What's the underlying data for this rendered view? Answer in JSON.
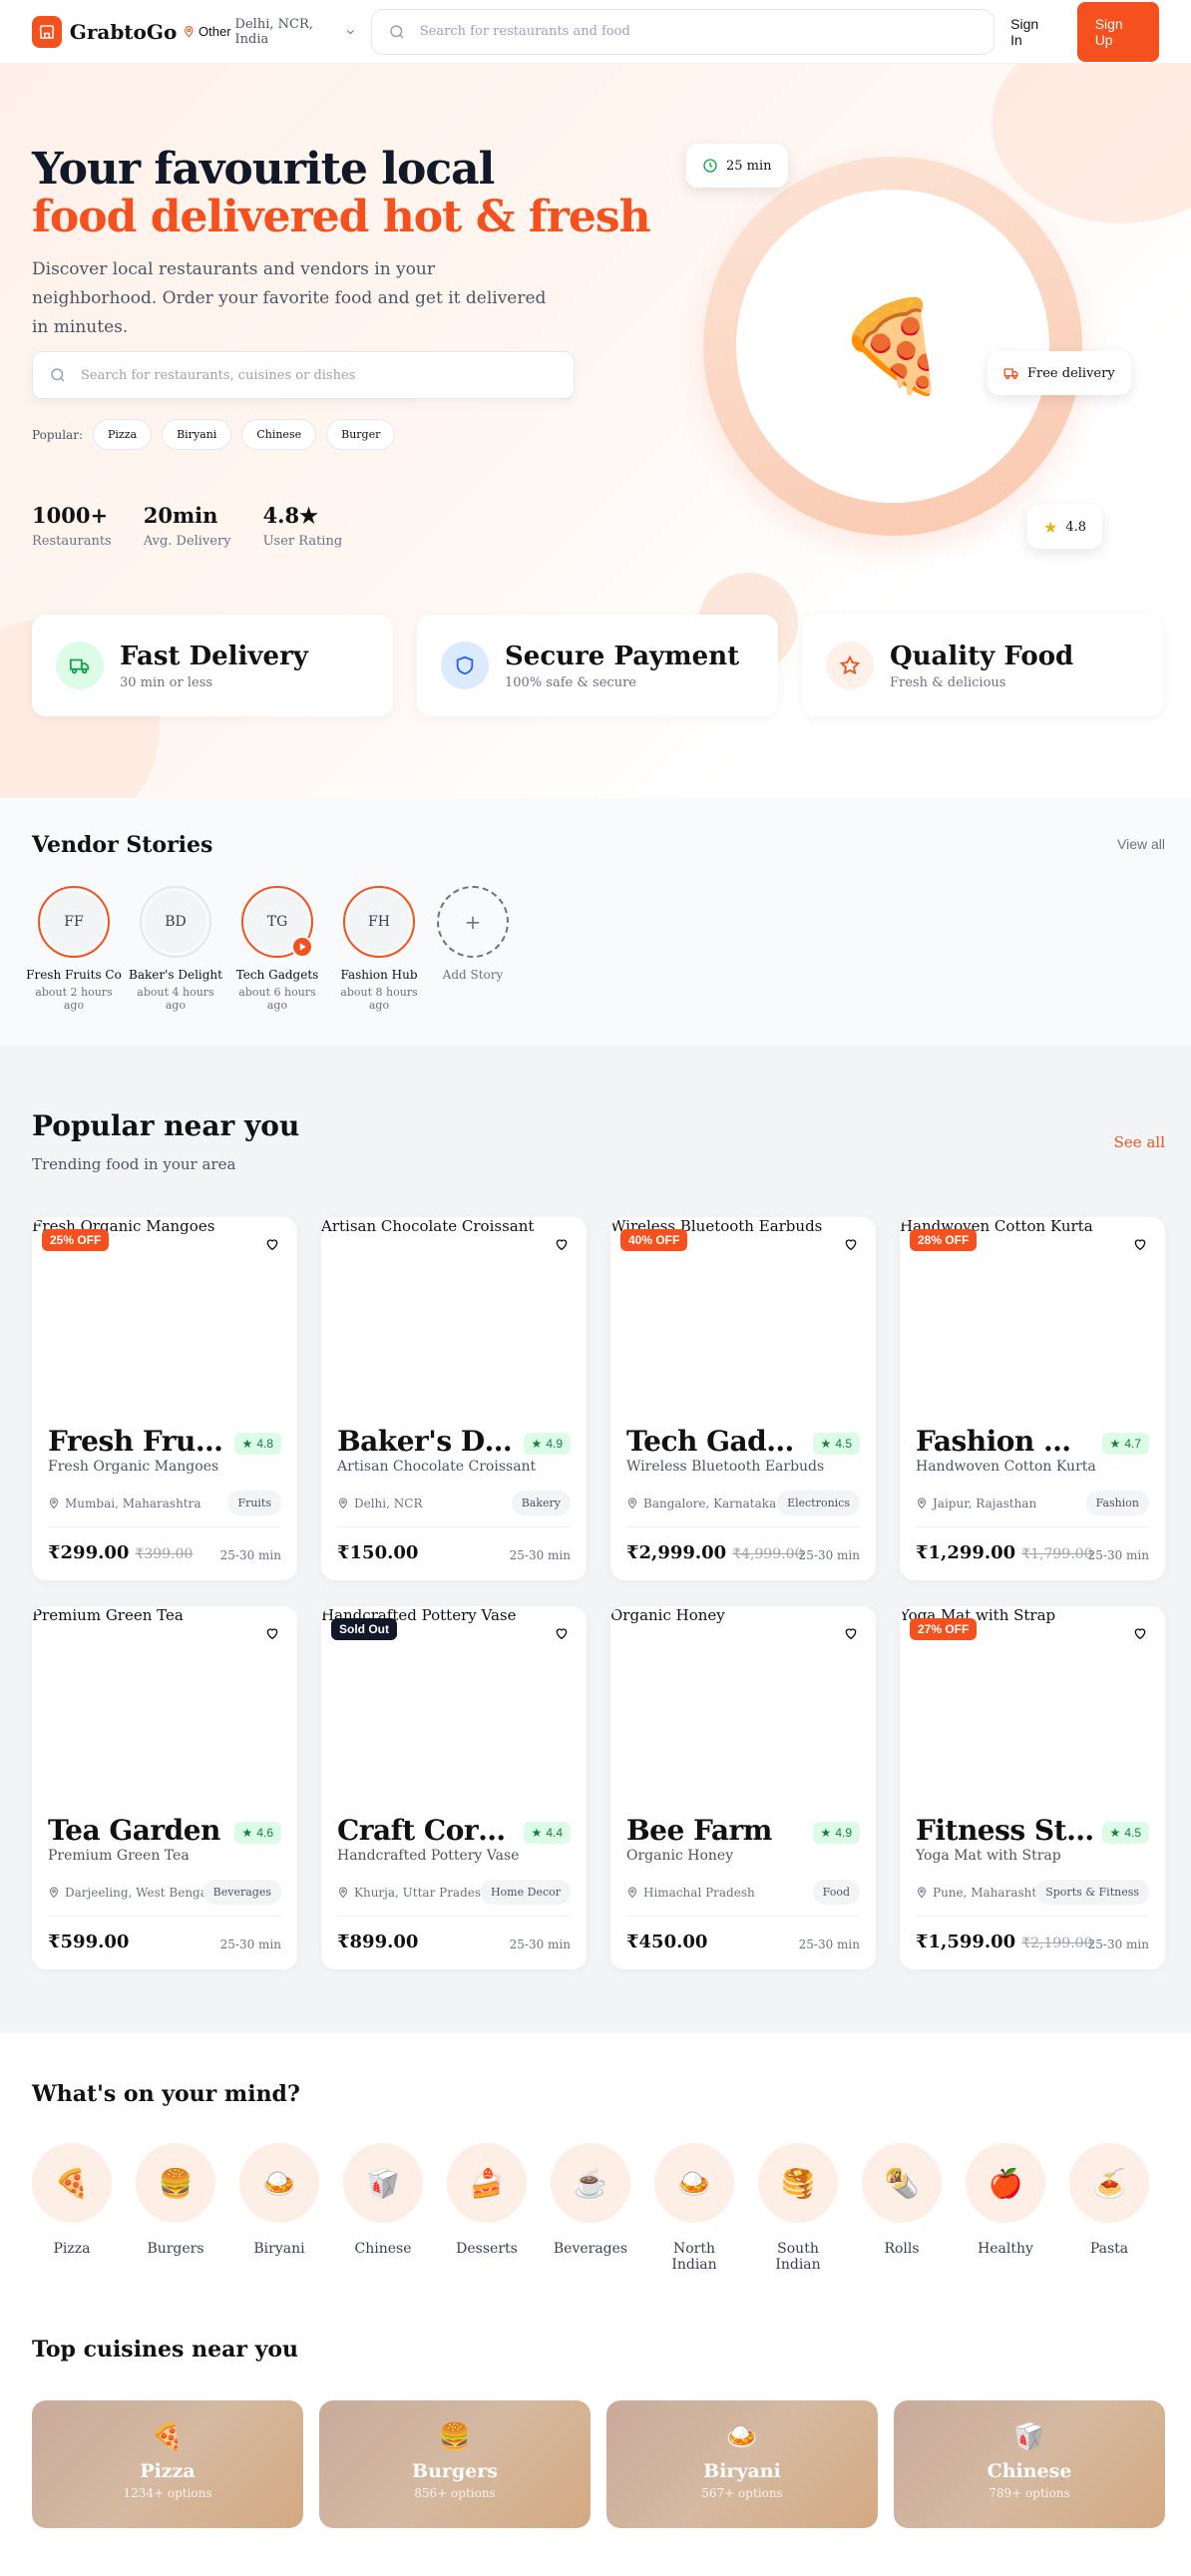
{
  "header": {
    "brand": "GrabtoGo",
    "location_type": "Other",
    "location": "Delhi, NCR, India",
    "search_placeholder": "Search for restaurants and food",
    "signin": "Sign In",
    "signup": "Sign Up"
  },
  "hero": {
    "title_line1": "Your favourite local",
    "title_line2": "food delivered hot & fresh",
    "description": "Discover local restaurants and vendors in your neighborhood. Order your favorite food and get it delivered in minutes.",
    "search_placeholder": "Search for restaurants, cuisines or dishes",
    "popular_label": "Popular:",
    "popular_chips": [
      "Pizza",
      "Biryani",
      "Chinese",
      "Burger"
    ],
    "stats": [
      {
        "value": "1000+",
        "label": "Restaurants"
      },
      {
        "value": "20min",
        "label": "Avg. Delivery"
      },
      {
        "value": "4.8★",
        "label": "User Rating"
      }
    ],
    "badge_time": "25 min",
    "badge_delivery": "Free delivery",
    "badge_rating": "4.8",
    "hero_emoji": "🍕"
  },
  "features": [
    {
      "title": "Fast Delivery",
      "sub": "30 min or less",
      "icon": "truck-icon",
      "color": "#16a34a"
    },
    {
      "title": "Secure Payment",
      "sub": "100% safe & secure",
      "icon": "shield-icon",
      "color": "#2563eb"
    },
    {
      "title": "Quality Food",
      "sub": "Fresh & delicious",
      "icon": "star-icon",
      "color": "#f4511e"
    }
  ],
  "stories": {
    "title": "Vendor Stories",
    "view_all": "View all",
    "items": [
      {
        "initials": "FF",
        "name": "Fresh Fruits Co",
        "time": "about 2 hours ago"
      },
      {
        "initials": "BD",
        "name": "Baker's Delight",
        "time": "about 4 hours ago"
      },
      {
        "initials": "TG",
        "name": "Tech Gadgets",
        "time": "about 6 hours ago"
      },
      {
        "initials": "FH",
        "name": "Fashion Hub",
        "time": "about 8 hours ago"
      }
    ],
    "add_label": "Add Story",
    "add_symbol": "+"
  },
  "popular": {
    "title": "Popular near you",
    "subtitle": "Trending food in your area",
    "see_all": "See all",
    "cards": [
      {
        "alt": "Fresh Organic Mangoes",
        "badge": "25% OFF",
        "name": "Fresh Fruits Co",
        "rating": "4.8",
        "product": "Fresh Organic Mangoes",
        "location": "Mumbai, Maharashtra",
        "category": "Fruits",
        "price": "₹299.00",
        "original": "₹399.00",
        "time": "25-30 min"
      },
      {
        "alt": "Artisan Chocolate Croissant",
        "badge": "",
        "name": "Baker's Delight",
        "rating": "4.9",
        "product": "Artisan Chocolate Croissant",
        "location": "Delhi, NCR",
        "category": "Bakery",
        "price": "₹150.00",
        "original": "",
        "time": "25-30 min"
      },
      {
        "alt": "Wireless Bluetooth Earbuds",
        "badge": "40% OFF",
        "name": "Tech Gadgets",
        "rating": "4.5",
        "product": "Wireless Bluetooth Earbuds",
        "location": "Bangalore, Karnataka",
        "category": "Electronics",
        "price": "₹2,999.00",
        "original": "₹4,999.00",
        "time": "25-30 min"
      },
      {
        "alt": "Handwoven Cotton Kurta",
        "badge": "28% OFF",
        "name": "Fashion Hub",
        "rating": "4.7",
        "product": "Handwoven Cotton Kurta",
        "location": "Jaipur, Rajasthan",
        "category": "Fashion",
        "price": "₹1,299.00",
        "original": "₹1,799.00",
        "time": "25-30 min"
      },
      {
        "alt": "Premium Green Tea",
        "badge": "",
        "name": "Tea Garden",
        "rating": "4.6",
        "product": "Premium Green Tea",
        "location": "Darjeeling, West Bengal",
        "category": "Beverages",
        "price": "₹599.00",
        "original": "",
        "time": "25-30 min"
      },
      {
        "alt": "Handcrafted Pottery Vase",
        "badge": "Sold Out",
        "name": "Craft Corner",
        "rating": "4.4",
        "product": "Handcrafted Pottery Vase",
        "location": "Khurja, Uttar Pradesh",
        "category": "Home Decor",
        "price": "₹899.00",
        "original": "",
        "time": "25-30 min"
      },
      {
        "alt": "Organic Honey",
        "badge": "",
        "name": "Bee Farm",
        "rating": "4.9",
        "product": "Organic Honey",
        "location": "Himachal Pradesh",
        "category": "Food",
        "price": "₹450.00",
        "original": "",
        "time": "25-30 min"
      },
      {
        "alt": "Yoga Mat with Strap",
        "badge": "27% OFF",
        "name": "Fitness Store",
        "rating": "4.5",
        "product": "Yoga Mat with Strap",
        "location": "Pune, Maharashtra",
        "category": "Sports & Fitness",
        "price": "₹1,599.00",
        "original": "₹2,199.00",
        "time": "25-30 min"
      }
    ]
  },
  "mind": {
    "title": "What's on your mind?",
    "items": [
      {
        "label": "Pizza",
        "glyph": "🍕"
      },
      {
        "label": "Burgers",
        "glyph": "🍔"
      },
      {
        "label": "Biryani",
        "glyph": "🍛"
      },
      {
        "label": "Chinese",
        "glyph": "🥡"
      },
      {
        "label": "Desserts",
        "glyph": "🍰"
      },
      {
        "label": "Beverages",
        "glyph": "☕"
      },
      {
        "label": "North Indian",
        "glyph": "🍛"
      },
      {
        "label": "South Indian",
        "glyph": "🥞"
      },
      {
        "label": "Rolls",
        "glyph": "🌯"
      },
      {
        "label": "Healthy",
        "glyph": "🍎"
      },
      {
        "label": "Pasta",
        "glyph": "🍝"
      }
    ]
  },
  "cuisines": {
    "title": "Top cuisines near you",
    "items": [
      {
        "name": "Pizza",
        "options": "1234+ options",
        "glyph": "🍕"
      },
      {
        "name": "Burgers",
        "options": "856+ options",
        "glyph": "🍔"
      },
      {
        "name": "Biryani",
        "options": "567+ options",
        "glyph": "🍛"
      },
      {
        "name": "Chinese",
        "options": "789+ options",
        "glyph": "🥡"
      }
    ]
  },
  "colors": {
    "accent": "#f4511e",
    "rating_bg": "#dcfce7",
    "rating_fg": "#15803d"
  }
}
